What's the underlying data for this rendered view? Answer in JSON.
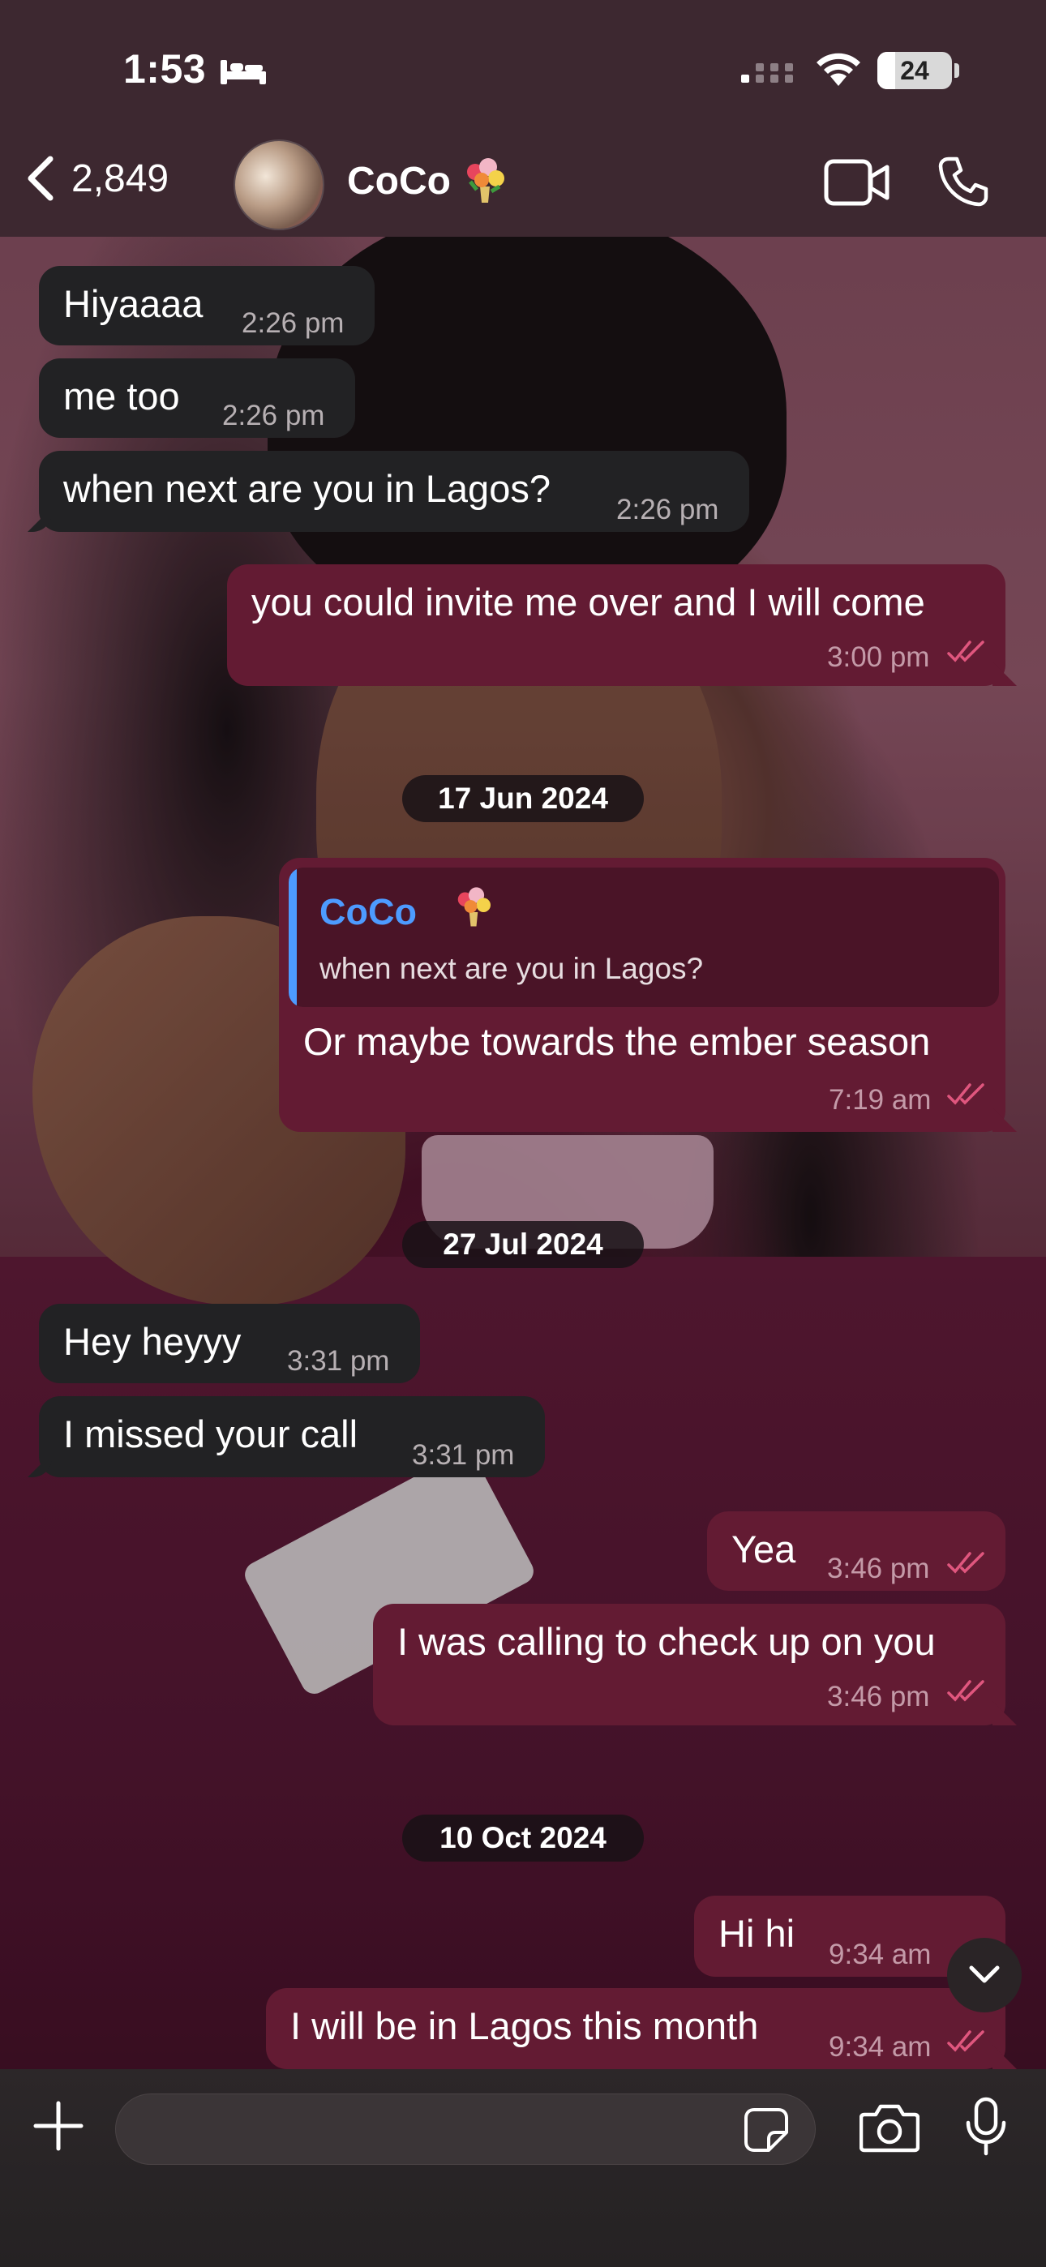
{
  "status_bar": {
    "time": "1:53",
    "battery": "24"
  },
  "header": {
    "back_count": "2,849",
    "contact_name": "CoCo",
    "contact_emoji": "💐"
  },
  "messages": [
    {
      "dir": "in",
      "text": "Hiyaaaa",
      "time": "2:26 pm"
    },
    {
      "dir": "in",
      "text": "me too",
      "time": "2:26 pm"
    },
    {
      "dir": "in",
      "text": "when next are you in Lagos?",
      "time": "2:26 pm"
    },
    {
      "dir": "out",
      "text": "you could invite me over and I will come",
      "time": "3:00 pm"
    },
    {
      "dir": "out",
      "text": "Or maybe towards the ember season",
      "time": "7:19 am",
      "reply": {
        "name": "CoCo",
        "text": "when next are you in Lagos?"
      }
    },
    {
      "dir": "in",
      "text": "Hey heyyy",
      "time": "3:31 pm"
    },
    {
      "dir": "in",
      "text": "I missed your call",
      "time": "3:31 pm"
    },
    {
      "dir": "out",
      "text": "Yea",
      "time": "3:46 pm"
    },
    {
      "dir": "out",
      "text": "I was calling to check up on you",
      "time": "3:46 pm"
    },
    {
      "dir": "out",
      "text": "Hi hi",
      "time": "9:34 am"
    },
    {
      "dir": "out",
      "text": "I will be in Lagos this month",
      "time": "9:34 am"
    }
  ],
  "dates": [
    "17 Jun 2024",
    "27 Jul 2024",
    "10 Oct 2024"
  ],
  "colors": {
    "accent_blue": "#4d9bff",
    "outgoing_bubble": "#631b33",
    "incoming_bubble": "#222224",
    "read_ticks": "#e0567e"
  },
  "icons": [
    "bed-icon",
    "signal-icon",
    "wifi-icon",
    "back-chevron-icon",
    "video-call-icon",
    "phone-icon",
    "plus-icon",
    "sticker-icon",
    "camera-icon",
    "microphone-icon",
    "chevron-down-icon"
  ]
}
